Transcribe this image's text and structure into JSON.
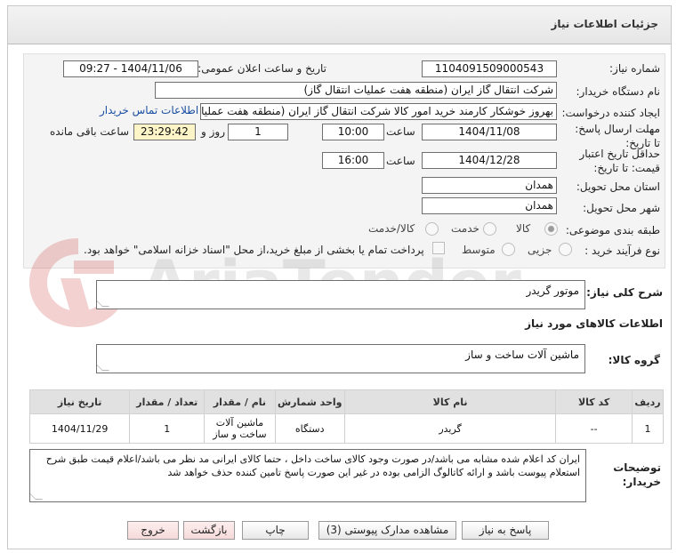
{
  "header": {
    "title": "جزئیات اطلاعات نیاز"
  },
  "form": {
    "need_number_label": "شماره نیاز:",
    "need_number": "1104091509000543",
    "announce_label": "تاریخ و ساعت اعلان عمومی:",
    "announce_value": "1404/11/06 - 09:27",
    "buyer_label": "نام دستگاه خریدار:",
    "buyer_value": "شرکت انتقال گاز ایران (منطقه هفت عملیات انتقال گاز)",
    "creator_label": "ایجاد کننده درخواست:",
    "creator_value": "بهروز خوشکار کارمند خرید امور کالا شرکت انتقال گاز ایران (منطقه هفت عملیات",
    "contact_link": "اطلاعات تماس خریدار",
    "deadline_label": "مهلت ارسال پاسخ: تا تاریخ:",
    "deadline_date": "1404/11/08",
    "time_label": "ساعت",
    "deadline_time": "10:00",
    "days_value": "1",
    "days_label": "روز و",
    "remaining_time": "23:29:42",
    "remaining_label": "ساعت باقی مانده",
    "validity_label": "حداقل تاریخ اعتبار قیمت: تا تاریخ:",
    "validity_date": "1404/12/28",
    "validity_time": "16:00",
    "province_label": "استان محل تحویل:",
    "province_value": "همدان",
    "city_label": "شهر محل تحویل:",
    "city_value": "همدان",
    "category_label": "طبقه بندی موضوعی:",
    "category_options": [
      "کالا",
      "خدمت",
      "کالا/خدمت"
    ],
    "category_selected": "کالا",
    "process_label": "نوع فرآیند خرید :",
    "process_options": [
      "جزیی",
      "متوسط"
    ],
    "payment_note": "پرداخت تمام یا بخشی از مبلغ خرید،از محل \"اسناد خزانه اسلامی\" خواهد بود."
  },
  "description": {
    "label": "شرح کلی نیاز:",
    "value": "موتور گریدر"
  },
  "goods_section_title": "اطلاعات کالاهای مورد نیاز",
  "goods_group": {
    "label": "گروه کالا:",
    "value": "ماشین آلات ساخت و ساز"
  },
  "table": {
    "headers": [
      "ردیف",
      "کد کالا",
      "نام کالا",
      "واحد شمارش",
      "نام / مقدار",
      "تعداد / مقدار",
      "تاریخ نیاز"
    ],
    "rows": [
      {
        "row": "1",
        "code": "--",
        "name": "گریدر",
        "unit": "دستگاه",
        "group": "ماشین آلات ساخت و ساز",
        "qty": "1",
        "date": "1404/11/29"
      }
    ]
  },
  "buyer_notes": {
    "label": "توضیحات خریدار:",
    "value": "ایران کد اعلام شده مشابه می باشد/در صورت وجود کالای ساخت داخل ، حتما کالای ایرانی مد نظر می باشد/اعلام قیمت طبق شرح استعلام پیوست باشد و ارائه کاتالوگ الزامی بوده در غیر این صورت پاسخ تامین کننده حذف خواهد شد"
  },
  "buttons": {
    "reply": "پاسخ به نیاز",
    "attachments": "مشاهده مدارک پیوستی (3)",
    "print": "چاپ",
    "back": "بازگشت",
    "exit": "خروج"
  },
  "watermark": "AriaTender.net"
}
